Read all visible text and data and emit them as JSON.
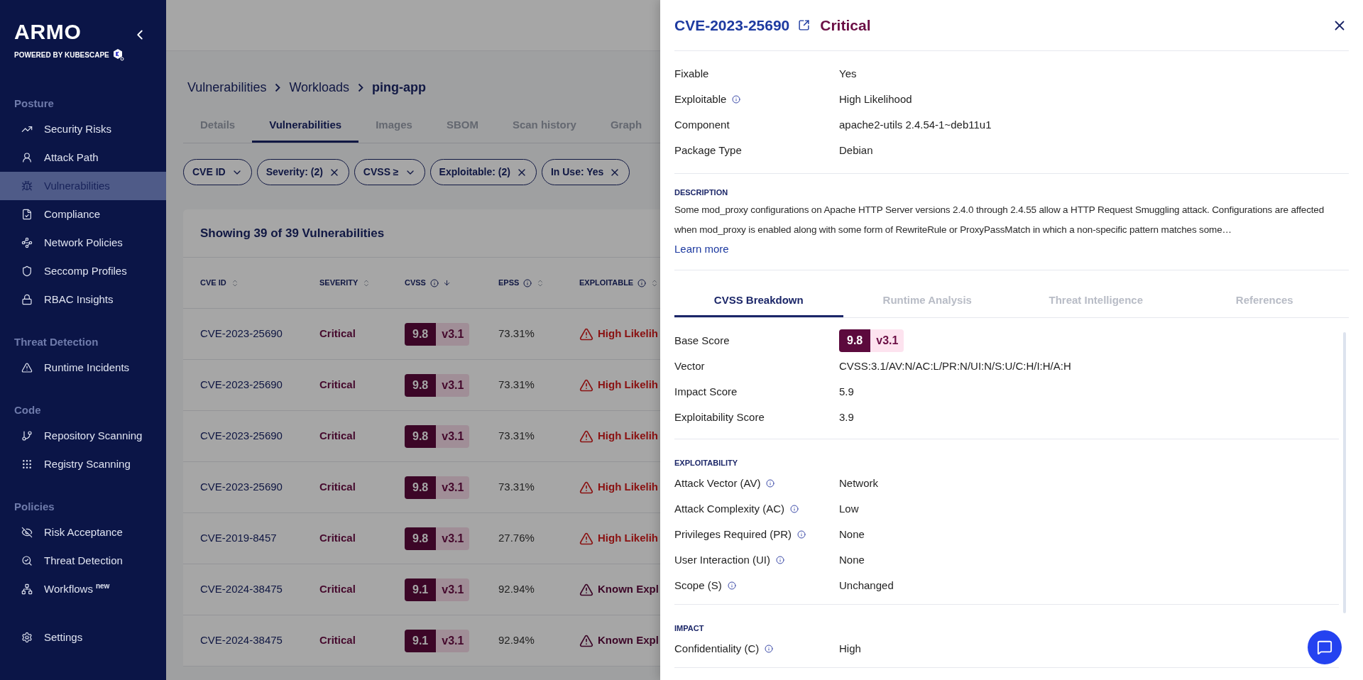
{
  "sidebar": {
    "logo": "ARMO",
    "tagline": "POWERED BY KUBESCAPE",
    "sections": [
      {
        "title": "Posture",
        "items": [
          {
            "label": "Security Risks",
            "selected": false
          },
          {
            "label": "Attack Path",
            "selected": false
          },
          {
            "label": "Vulnerabilities",
            "selected": true
          },
          {
            "label": "Compliance",
            "selected": false
          },
          {
            "label": "Network Policies",
            "selected": false
          },
          {
            "label": "Seccomp Profiles",
            "selected": false
          },
          {
            "label": "RBAC Insights",
            "selected": false
          }
        ]
      },
      {
        "title": "Threat Detection",
        "items": [
          {
            "label": "Runtime Incidents",
            "selected": false
          }
        ]
      },
      {
        "title": "Code",
        "items": [
          {
            "label": "Repository Scanning",
            "selected": false
          },
          {
            "label": "Registry Scanning",
            "selected": false
          }
        ]
      },
      {
        "title": "Policies",
        "items": [
          {
            "label": "Risk Acceptance",
            "selected": false
          },
          {
            "label": "Threat Detection",
            "selected": false
          },
          {
            "label": "Workflows",
            "badge": "new",
            "selected": false
          }
        ]
      }
    ],
    "footer": {
      "label": "Settings",
      "selected": false
    }
  },
  "main": {
    "breadcrumb": [
      "Vulnerabilities",
      "Workloads",
      "ping-app"
    ],
    "tabs": [
      {
        "label": "Details",
        "selected": false
      },
      {
        "label": "Vulnerabilities",
        "selected": true
      },
      {
        "label": "Images",
        "selected": false
      },
      {
        "label": "SBOM",
        "selected": false
      },
      {
        "label": "Scan history",
        "selected": false
      },
      {
        "label": "Graph",
        "selected": false
      }
    ],
    "filters": [
      {
        "label": "CVE ID",
        "kind": "dropdown"
      },
      {
        "label": "Severity: (2)",
        "kind": "removable"
      },
      {
        "label": "CVSS ≥",
        "kind": "dropdown"
      },
      {
        "label": "Exploitable: (2)",
        "kind": "removable"
      },
      {
        "label": "In Use: Yes",
        "kind": "removable"
      }
    ],
    "table": {
      "title": "Showing 39 of 39 Vulnerabilities",
      "columns": [
        {
          "label": "CVE ID",
          "info": false,
          "sorted": false
        },
        {
          "label": "SEVERITY",
          "info": false,
          "sorted": false
        },
        {
          "label": "CVSS",
          "info": true,
          "sorted": true
        },
        {
          "label": "EPSS",
          "info": true,
          "sorted": false
        },
        {
          "label": "EXPLOITABLE",
          "info": true,
          "sorted": false
        }
      ],
      "rows": [
        {
          "cve": "CVE-2023-25690",
          "severity": "Critical",
          "score": "9.8",
          "version": "v3.1",
          "epss": "73.31%",
          "exploitable": "High Likelih",
          "kind": "high"
        },
        {
          "cve": "CVE-2023-25690",
          "severity": "Critical",
          "score": "9.8",
          "version": "v3.1",
          "epss": "73.31%",
          "exploitable": "High Likelih",
          "kind": "high"
        },
        {
          "cve": "CVE-2023-25690",
          "severity": "Critical",
          "score": "9.8",
          "version": "v3.1",
          "epss": "73.31%",
          "exploitable": "High Likelih",
          "kind": "high"
        },
        {
          "cve": "CVE-2023-25690",
          "severity": "Critical",
          "score": "9.8",
          "version": "v3.1",
          "epss": "73.31%",
          "exploitable": "High Likelih",
          "kind": "high"
        },
        {
          "cve": "CVE-2019-8457",
          "severity": "Critical",
          "score": "9.8",
          "version": "v3.1",
          "epss": "27.76%",
          "exploitable": "High Likelih",
          "kind": "high"
        },
        {
          "cve": "CVE-2024-38475",
          "severity": "Critical",
          "score": "9.1",
          "version": "v3.1",
          "epss": "92.94%",
          "exploitable": "Known Expl",
          "kind": "known"
        },
        {
          "cve": "CVE-2024-38475",
          "severity": "Critical",
          "score": "9.1",
          "version": "v3.1",
          "epss": "92.94%",
          "exploitable": "Known Expl",
          "kind": "known"
        }
      ]
    }
  },
  "drawer": {
    "title": "CVE-2023-25690",
    "severity": "Critical",
    "details": [
      {
        "label": "Fixable",
        "value": "Yes",
        "info": false
      },
      {
        "label": "Exploitable",
        "value": "High Likelihood",
        "info": true
      },
      {
        "label": "Component",
        "value": "apache2-utils 2.4.54-1~deb11u1",
        "info": false
      },
      {
        "label": "Package Type",
        "value": "Debian",
        "info": false
      }
    ],
    "description": {
      "heading": "DESCRIPTION",
      "text": "Some mod_proxy configurations on Apache HTTP Server versions 2.4.0 through 2.4.55 allow a HTTP Request Smuggling attack. Configurations are affected when mod_proxy is enabled along with some form of RewriteRule or ProxyPassMatch in which a non-specific pattern matches some…",
      "link": "Learn more"
    },
    "tabs": [
      {
        "label": "CVSS Breakdown",
        "selected": true
      },
      {
        "label": "Runtime Analysis",
        "selected": false
      },
      {
        "label": "Threat Intelligence",
        "selected": false
      },
      {
        "label": "References",
        "selected": false
      }
    ],
    "scores": {
      "base_label": "Base Score",
      "score": "9.8",
      "version": "v3.1",
      "rows": [
        {
          "label": "Vector",
          "value": "CVSS:3.1/AV:N/AC:L/PR:N/UI:N/S:U/C:H/I:H/A:H"
        },
        {
          "label": "Impact Score",
          "value": "5.9"
        },
        {
          "label": "Exploitability Score",
          "value": "3.9"
        }
      ]
    },
    "groups": [
      {
        "heading": "EXPLOITABILITY",
        "rows": [
          {
            "label": "Attack Vector (AV)",
            "value": "Network"
          },
          {
            "label": "Attack Complexity (AC)",
            "value": "Low"
          },
          {
            "label": "Privileges Required (PR)",
            "value": "None"
          },
          {
            "label": "User Interaction (UI)",
            "value": "None"
          },
          {
            "label": "Scope (S)",
            "value": "Unchanged"
          }
        ]
      },
      {
        "heading": "IMPACT",
        "rows": [
          {
            "label": "Confidentiality (C)",
            "value": "High"
          }
        ]
      }
    ]
  }
}
